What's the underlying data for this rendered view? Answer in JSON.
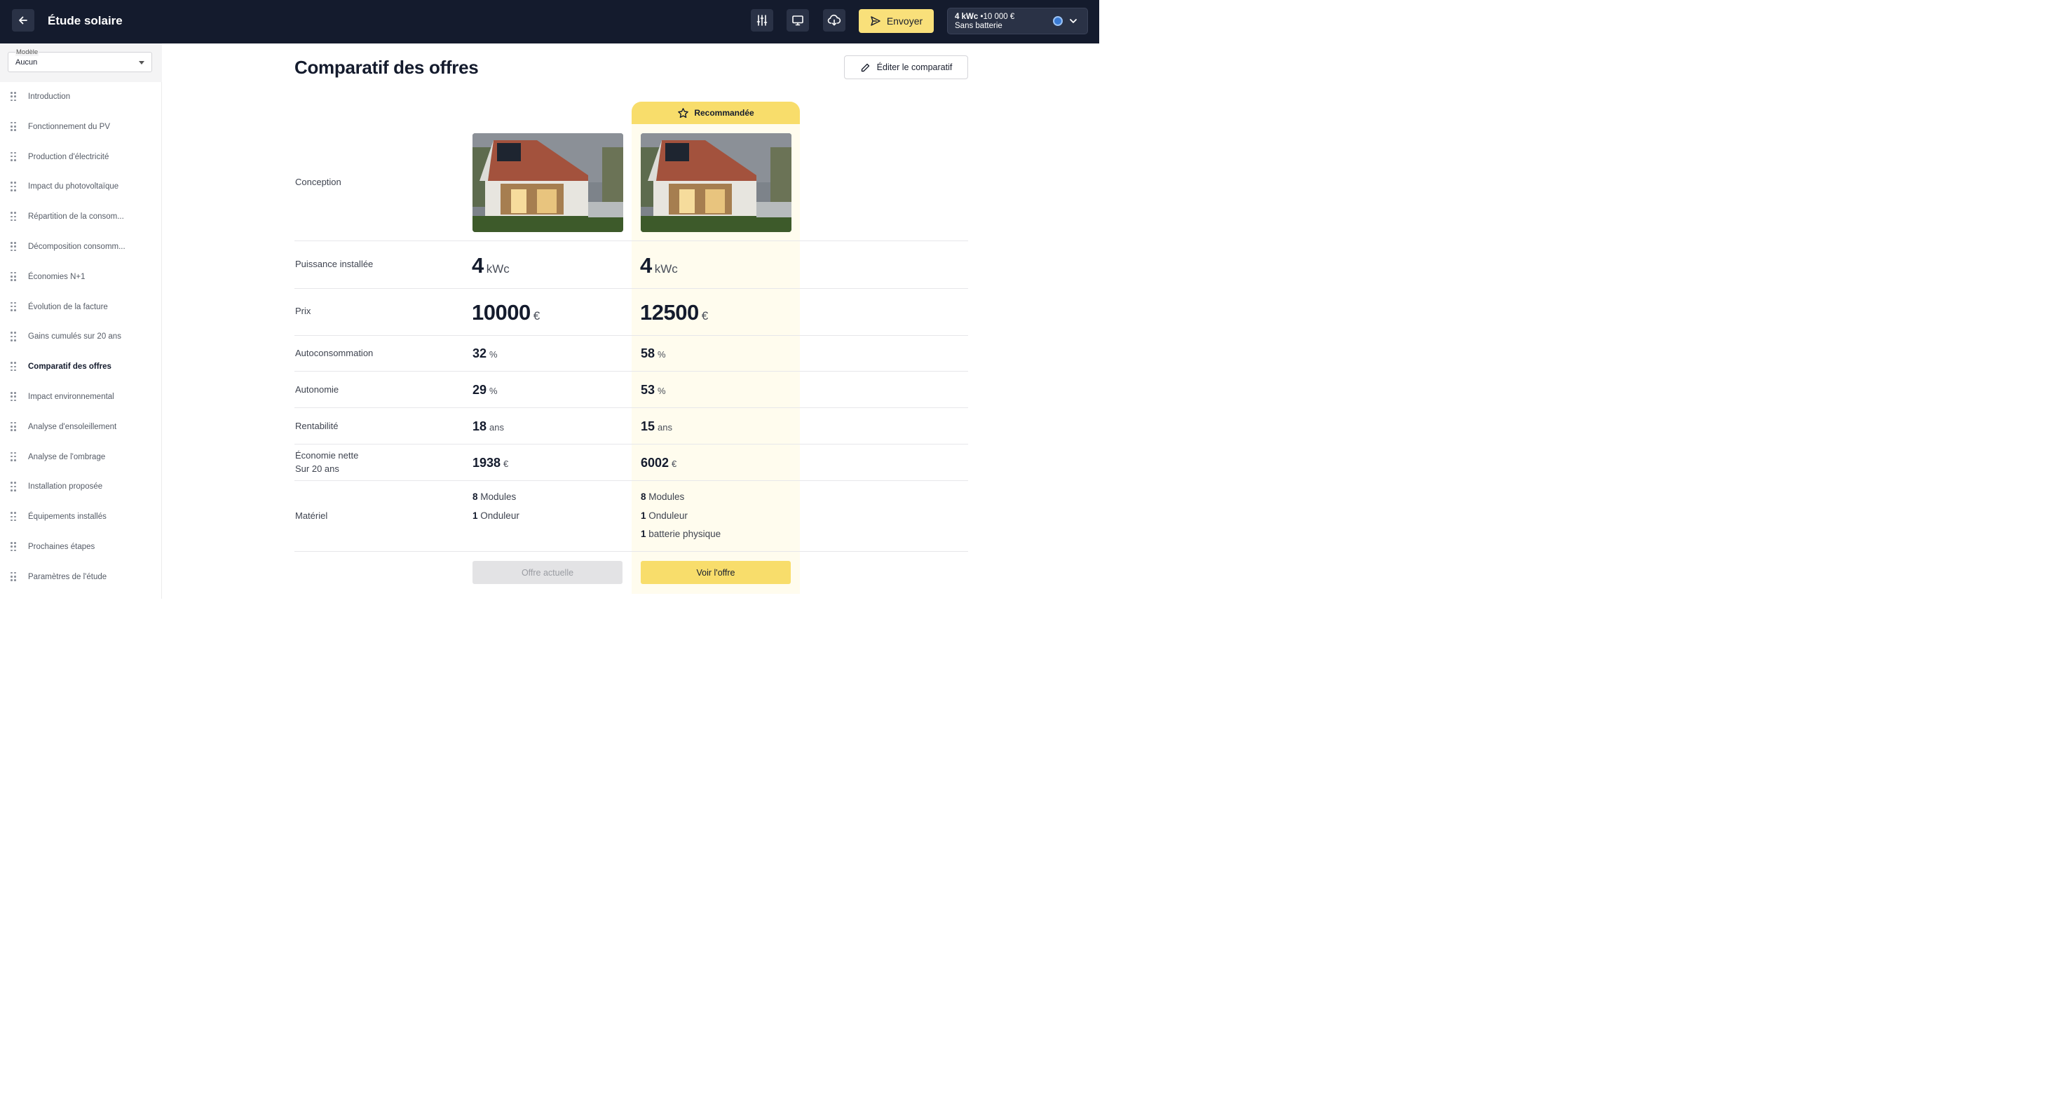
{
  "header": {
    "title": "Étude solaire",
    "send_label": "Envoyer",
    "offer_power": "4 kWc",
    "offer_price": "•10 000 €",
    "offer_battery": "Sans batterie",
    "icons": [
      "back-arrow-icon",
      "sliders-icon",
      "monitor-icon",
      "cloud-download-icon",
      "send-icon",
      "chevron-down-icon"
    ]
  },
  "sidebar": {
    "model_label": "Modèle",
    "model_value": "Aucun",
    "items": [
      {
        "label": "Introduction"
      },
      {
        "label": "Fonctionnement du PV"
      },
      {
        "label": "Production d'électricité"
      },
      {
        "label": "Impact du photovoltaïque"
      },
      {
        "label": "Répartition de la consom..."
      },
      {
        "label": "Décomposition consomm..."
      },
      {
        "label": "Économies N+1"
      },
      {
        "label": "Évolution de la facture"
      },
      {
        "label": "Gains cumulés sur 20 ans"
      },
      {
        "label": "Comparatif des offres",
        "active": true
      },
      {
        "label": "Impact environnemental"
      },
      {
        "label": "Analyse d'ensoleillement"
      },
      {
        "label": "Analyse de l'ombrage"
      },
      {
        "label": "Installation proposée"
      },
      {
        "label": "Équipements installés"
      },
      {
        "label": "Prochaines étapes"
      },
      {
        "label": "Paramètres de l'étude"
      }
    ]
  },
  "main": {
    "title": "Comparatif des offres",
    "edit_label": "Éditer le comparatif",
    "recommended_label": "Recommandée",
    "rows": {
      "conception": "Conception",
      "power": "Puissance installée",
      "price": "Prix",
      "selfcons": "Autoconsommation",
      "autonomy": "Autonomie",
      "profit": "Rentabilité",
      "savings": "Économie nette",
      "savings_sub": "Sur 20 ans",
      "material": "Matériel"
    },
    "offers": [
      {
        "power": "4",
        "power_unit": "kWc",
        "price": "10000",
        "price_unit": "€",
        "selfcons": "32",
        "selfcons_unit": "%",
        "autonomy": "29",
        "autonomy_unit": "%",
        "profit": "18",
        "profit_unit": "ans",
        "savings": "1938",
        "savings_unit": "€",
        "modules_qty": "8",
        "modules_label": "Modules",
        "inverter_qty": "1",
        "inverter_label": "Onduleur",
        "button": "Offre actuelle"
      },
      {
        "power": "4",
        "power_unit": "kWc",
        "price": "12500",
        "price_unit": "€",
        "selfcons": "58",
        "selfcons_unit": "%",
        "autonomy": "53",
        "autonomy_unit": "%",
        "profit": "15",
        "profit_unit": "ans",
        "savings": "6002",
        "savings_unit": "€",
        "modules_qty": "8",
        "modules_label": "Modules",
        "inverter_qty": "1",
        "inverter_label": "Onduleur",
        "battery_qty": "1",
        "battery_label": "batterie physique",
        "button": "Voir l'offre"
      }
    ]
  },
  "colors": {
    "header_bg": "#141b2d",
    "accent_yellow": "#f8dd6b",
    "recommended_bg": "#fffcee"
  }
}
